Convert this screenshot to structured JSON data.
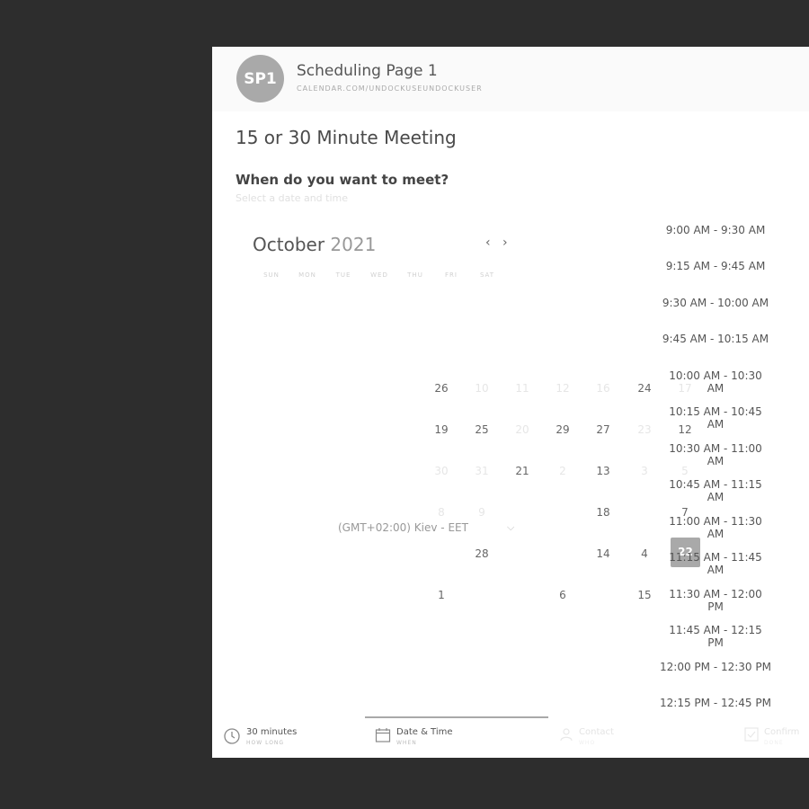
{
  "header": {
    "avatar_initials": "SP1",
    "page_title": "Scheduling Page 1",
    "page_url": "CALENDAR.COM/UNDOCKUSEUNDOCKUSER"
  },
  "meeting": {
    "title": "15 or 30 Minute Meeting",
    "question": "When do you want to meet?",
    "question_sub": "Select a date and time"
  },
  "calendar": {
    "month": "October",
    "year": "2021",
    "prev_icon": "chevron-left-icon",
    "next_icon": "chevron-right-icon",
    "weekdays": [
      "SUN",
      "MON",
      "TUE",
      "WED",
      "THU",
      "FRI",
      "SAT"
    ],
    "days": [
      {
        "label": "26",
        "state": "dark"
      },
      {
        "label": "24",
        "state": "dark"
      },
      {
        "label": "19",
        "state": "dark"
      },
      {
        "label": "25",
        "state": "dark"
      },
      {
        "label": "29",
        "state": "dark"
      },
      {
        "label": "27",
        "state": "dark"
      },
      {
        "label": "12",
        "state": "dark"
      },
      {
        "label": "21",
        "state": "dark"
      },
      {
        "label": "13",
        "state": "dark"
      },
      {
        "label": "18",
        "state": "dark"
      },
      {
        "label": "7",
        "state": "dark"
      },
      {
        "label": "28",
        "state": "dark"
      },
      {
        "label": "14",
        "state": "dark"
      },
      {
        "label": "4",
        "state": "dark"
      },
      {
        "label": "22",
        "state": "selected"
      },
      {
        "label": "1",
        "state": "dark"
      },
      {
        "label": "6",
        "state": "dark"
      },
      {
        "label": "15",
        "state": "dark"
      }
    ],
    "faded_days": [
      "10",
      "11",
      "12",
      "16",
      "17",
      "20",
      "23",
      "30",
      "31",
      "2",
      "3",
      "5",
      "8",
      "9"
    ]
  },
  "timezone": {
    "label": "(GMT+02:00) Kiev - EET",
    "icon": "chevron-down-icon"
  },
  "time_slots": [
    "9:00 AM - 9:30 AM",
    "9:15 AM - 9:45 AM",
    "9:30 AM - 10:00 AM",
    "9:45 AM - 10:15 AM",
    "10:00 AM - 10:30 AM",
    "10:15 AM - 10:45 AM",
    "10:30 AM - 11:00 AM",
    "10:45 AM - 11:15 AM",
    "11:00 AM - 11:30 AM",
    "11:15 AM - 11:45 AM",
    "11:30 AM - 12:00 PM",
    "11:45 AM - 12:15 PM",
    "12:00 PM - 12:30 PM",
    "12:15 PM - 12:45 PM"
  ],
  "footer": {
    "steps": [
      {
        "label": "30 minutes",
        "sub": "HOW LONG",
        "icon": "clock-icon"
      },
      {
        "label": "Date & Time",
        "sub": "WHEN",
        "icon": "calendar-icon"
      },
      {
        "label": "Contact",
        "sub": "WHO",
        "icon": "person-icon"
      },
      {
        "label": "Confirm",
        "sub": "DONE",
        "icon": "check-icon"
      }
    ]
  },
  "colors": {
    "background": "#2d2d2d",
    "card": "#ffffff",
    "accent": "#a9a9a9",
    "text": "#555555"
  }
}
